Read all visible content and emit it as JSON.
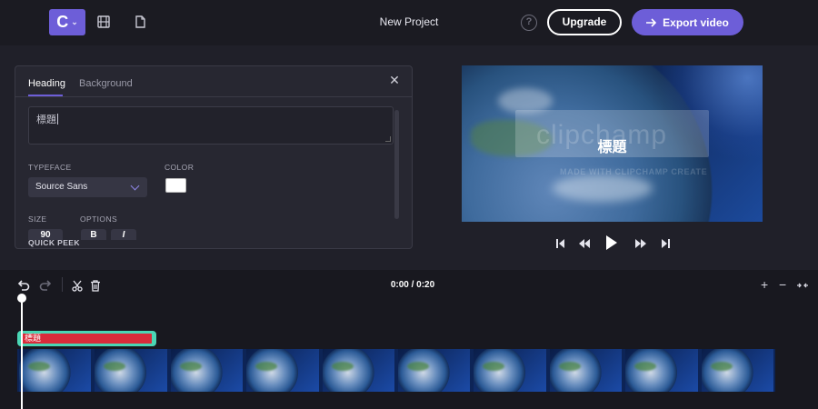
{
  "topbar": {
    "logo_letter": "C",
    "project_title": "New Project",
    "help_glyph": "?",
    "upgrade_label": "Upgrade",
    "export_label": "Export video",
    "icons": [
      "logo-menu-icon",
      "film-icon",
      "document-icon",
      "help-icon",
      "arrow-right-icon"
    ]
  },
  "panel": {
    "tabs": [
      {
        "label": "Heading",
        "active": true
      },
      {
        "label": "Background",
        "active": false
      }
    ],
    "text_value": "標題",
    "typeface_label": "TYPEFACE",
    "typeface_value": "Source Sans",
    "color_label": "COLOR",
    "color_value": "#ffffff",
    "size_label": "SIZE",
    "size_value": "90",
    "options_label": "OPTIONS",
    "bold_glyph": "B",
    "italic_glyph": "I",
    "quick_peek": "QUICK PEEK"
  },
  "preview": {
    "title_text": "標題",
    "watermark": "clipchamp",
    "watermark_sub": "MADE WITH CLIPCHAMP CREATE"
  },
  "timeline": {
    "timecode": "0:00 / 0:20",
    "text_clip_label": "標題",
    "clip_color": "#d92b3a",
    "clip_border_color": "#4ad6b5",
    "frame_count": 10
  },
  "colors": {
    "accent": "#6d5ed8",
    "background": "#202029"
  }
}
